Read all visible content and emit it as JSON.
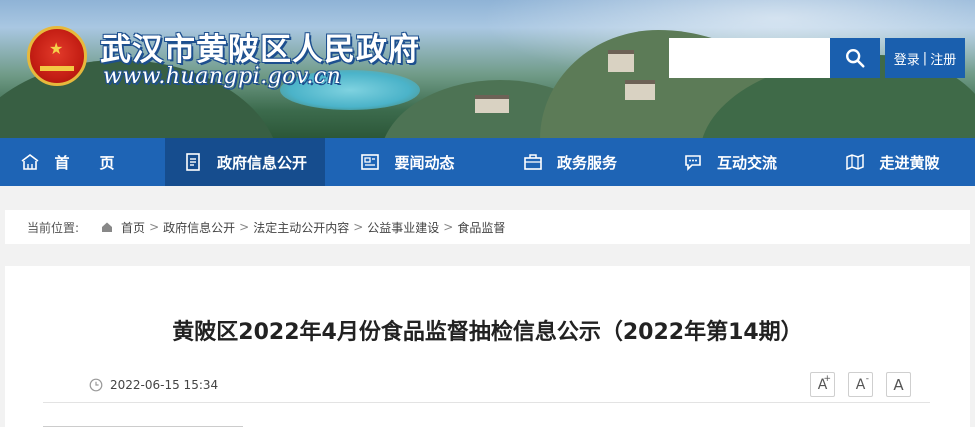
{
  "header": {
    "site_title": "武汉市黄陂区人民政府",
    "site_url": "www.huangpi.gov.cn",
    "search_placeholder": "",
    "login_label": "登录",
    "login_separator": "|",
    "register_label": "注册"
  },
  "nav": {
    "items": [
      {
        "label": "首页",
        "icon": "home-icon"
      },
      {
        "label": "政府信息公开",
        "icon": "document-icon",
        "active": true
      },
      {
        "label": "要闻动态",
        "icon": "news-icon"
      },
      {
        "label": "政务服务",
        "icon": "briefcase-icon"
      },
      {
        "label": "互动交流",
        "icon": "chat-icon"
      },
      {
        "label": "走进黄陂",
        "icon": "map-icon"
      }
    ]
  },
  "breadcrumb": {
    "prefix": "当前位置:",
    "items": [
      "首页",
      "政府信息公开",
      "法定主动公开内容",
      "公益事业建设",
      "食品监督"
    ],
    "separator": ">"
  },
  "article": {
    "title": "黄陂区2022年4月份食品监督抽检信息公示（2022年第14期）",
    "published": "2022-06-15 15:34",
    "font_buttons": [
      "A",
      "A",
      "A"
    ]
  },
  "colors": {
    "nav_bg": "#1e64b5",
    "nav_active": "#164d8e",
    "button_blue": "#1a5fae"
  }
}
